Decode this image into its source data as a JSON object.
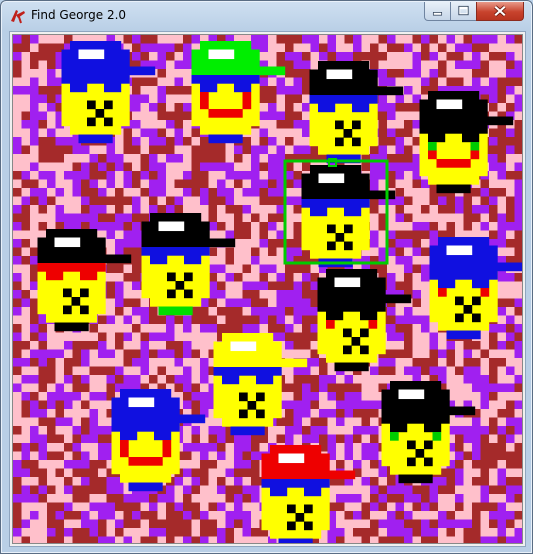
{
  "window": {
    "title": "Find George 2.0",
    "icon": "tk-feather-icon",
    "controls": [
      "minimize-icon",
      "maximize-icon",
      "close-icon"
    ]
  },
  "board": {
    "noise_colors": [
      "#a52a2a",
      "#a020f0",
      "#ffc0cb"
    ],
    "skin_color": "#ffff00",
    "highlight_color": "#00cc00",
    "faces": [
      {
        "name": "face-blue-cap-1",
        "cap": "#1010e0",
        "band": "#1010e0",
        "mouth": "none",
        "cheek": "none"
      },
      {
        "name": "face-green-cap",
        "cap": "#00ee00",
        "band": "#1010e0",
        "mouth": "smile",
        "cheek": "red"
      },
      {
        "name": "face-black-cap-1",
        "cap": "#000000",
        "band": "#1010e0",
        "mouth": "none",
        "cheek": "none"
      },
      {
        "name": "face-black-cap-2",
        "cap": "#000000",
        "band": "#000000",
        "mouth": "smile",
        "cheek": "green"
      },
      {
        "name": "face-black-cap-highlighted",
        "cap": "#000000",
        "band": "#1010e0",
        "mouth": "none",
        "cheek": "none"
      },
      {
        "name": "face-black-cap-3",
        "cap": "#000000",
        "band": "#1010e0",
        "mouth": "none",
        "cheek": "none"
      },
      {
        "name": "face-black-cap-4",
        "cap": "#000000",
        "band": "#ee0000",
        "mouth": "none",
        "cheek": "none"
      },
      {
        "name": "face-blue-cap-2",
        "cap": "#1010e0",
        "band": "#1010e0",
        "mouth": "none",
        "cheek": "red"
      },
      {
        "name": "face-black-cap-5",
        "cap": "#000000",
        "band": "#000000",
        "mouth": "none",
        "cheek": "red"
      },
      {
        "name": "face-yellow-cap",
        "cap": "#ffff00",
        "band": "#1010e0",
        "mouth": "none",
        "cheek": "none"
      },
      {
        "name": "face-blue-cap-3",
        "cap": "#1010e0",
        "band": "#1010e0",
        "mouth": "smile",
        "cheek": "red"
      },
      {
        "name": "face-black-cap-6",
        "cap": "#000000",
        "band": "#000000",
        "mouth": "none",
        "cheek": "green"
      },
      {
        "name": "face-red-cap",
        "cap": "#ee0000",
        "band": "#1010e0",
        "mouth": "none",
        "cheek": "none"
      }
    ]
  }
}
